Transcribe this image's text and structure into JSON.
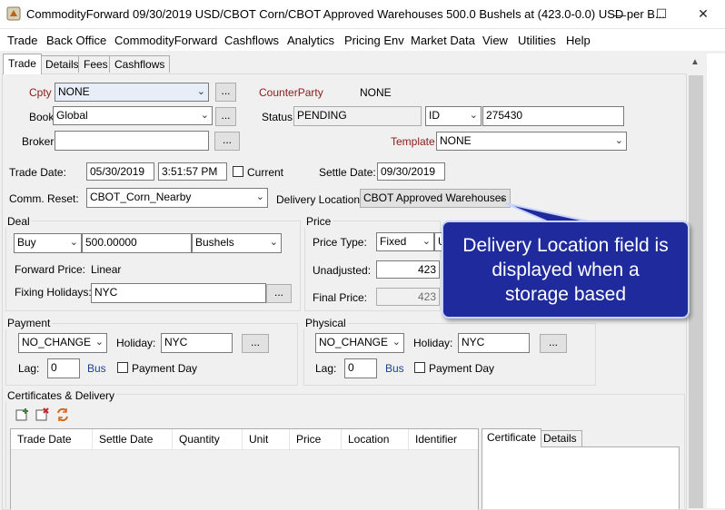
{
  "window": {
    "title": "CommodityForward 09/30/2019 USD/CBOT Corn/CBOT Approved Warehouses 500.0 Bushels at (423.0-0.0) USD  per B...",
    "minimize": "—",
    "maximize": "☐",
    "close": "✕"
  },
  "menu": [
    "Trade",
    "Back Office",
    "CommodityForward",
    "Cashflows",
    "Analytics",
    "Pricing Env",
    "Market Data",
    "View",
    "Utilities",
    "Help"
  ],
  "tabs": [
    "Trade",
    "Details",
    "Fees",
    "Cashflows"
  ],
  "trade": {
    "cpty_label": "Cpty",
    "cpty_value": "NONE",
    "counterparty_label": "CounterParty",
    "counterparty_value": "NONE",
    "book_label": "Book",
    "book_value": "Global",
    "status_label": "Status",
    "status_value": "PENDING",
    "id_type": "ID",
    "id_value": "275430",
    "broker_label": "Broker",
    "broker_value": "",
    "template_label": "Template",
    "template_value": "NONE",
    "ellipsis": "...",
    "trade_date_label": "Trade Date:",
    "trade_date": "05/30/2019",
    "trade_time": "3:51:57 PM",
    "current_label": "Current",
    "settle_date_label": "Settle Date:",
    "settle_date": "09/30/2019",
    "comm_reset_label": "Comm. Reset:",
    "comm_reset_value": "CBOT_Corn_Nearby",
    "delivery_location_label": "Delivery Location:",
    "delivery_location_value": "CBOT Approved Warehouses"
  },
  "deal": {
    "title": "Deal",
    "direction": "Buy",
    "quantity": "500.00000",
    "unit": "Bushels",
    "forward_price_label": "Forward Price:",
    "forward_price_value": "Linear",
    "fixing_holidays_label": "Fixing Holidays:",
    "fixing_holidays_value": "NYC"
  },
  "price": {
    "title": "Price",
    "price_type_label": "Price Type:",
    "price_type_value": "Fixed",
    "price_unit_partial": "U",
    "unadjusted_label": "Unadjusted:",
    "unadjusted_value": "423",
    "final_price_label": "Final Price:",
    "final_price_value": "423"
  },
  "payment": {
    "title": "Payment",
    "change": "NO_CHANGE",
    "holiday_label": "Holiday:",
    "holiday_value": "NYC",
    "lag_label": "Lag:",
    "lag_value": "0",
    "bus_label": "Bus",
    "payment_day_label": "Payment Day"
  },
  "physical": {
    "title": "Physical",
    "change": "NO_CHANGE",
    "holiday_label": "Holiday:",
    "holiday_value": "NYC",
    "lag_label": "Lag:",
    "lag_value": "0",
    "bus_label": "Bus",
    "payment_day_label": "Payment Day"
  },
  "certificates": {
    "title": "Certificates & Delivery",
    "columns": [
      "Trade Date",
      "Settle Date",
      "Quantity",
      "Unit",
      "Price",
      "Location",
      "Identifier"
    ],
    "side_tabs": [
      "Certificate",
      "Details"
    ]
  },
  "callout": {
    "line1": "Delivery Location field is",
    "line2": "displayed when a",
    "line3": "storage based"
  },
  "colors": {
    "callout_bg": "#1f2b9c",
    "label_red": "#8b1a1a",
    "label_blue": "#1f3f99"
  }
}
